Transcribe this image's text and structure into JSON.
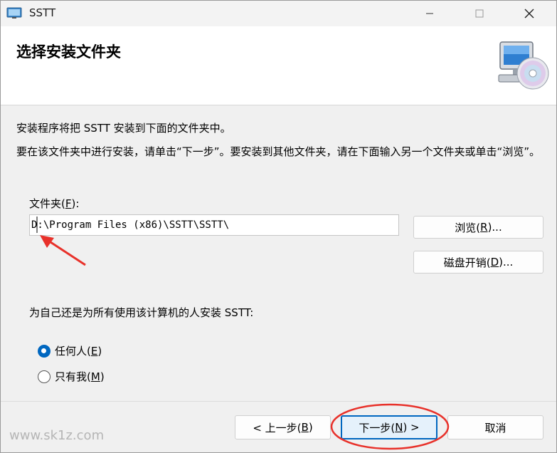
{
  "window": {
    "title": "SSTT",
    "icons": {
      "app": "installer-app-icon",
      "minimize": "minimize-icon",
      "maximize": "maximize-icon",
      "close": "close-icon"
    }
  },
  "header": {
    "title": "选择安装文件夹",
    "icon": "computer-with-disc-icon"
  },
  "body": {
    "description1": "安装程序将把 SSTT 安装到下面的文件夹中。",
    "description2": "要在该文件夹中进行安装，请单击“下一步”。要安装到其他文件夹，请在下面输入另一个文件夹或单击“浏览”。",
    "folder_label": "文件夹(F):",
    "folder_value": "D:\\Program Files (x86)\\SSTT\\SSTT\\",
    "browse_button": "浏览(R)...",
    "disk_cost_button": "磁盘开销(D)...",
    "install_for_label": "为自己还是为所有使用该计算机的人安装 SSTT:",
    "options": [
      {
        "label": "任何人(E)",
        "checked": true
      },
      {
        "label": "只有我(M)",
        "checked": false
      }
    ]
  },
  "footer": {
    "back_button": "< 上一步(B)",
    "next_button": "下一步(N) >",
    "cancel_button": "取消"
  },
  "watermark": "www.sk1z.com",
  "colors": {
    "accent": "#0067c0",
    "annotation": "#e8312a"
  }
}
